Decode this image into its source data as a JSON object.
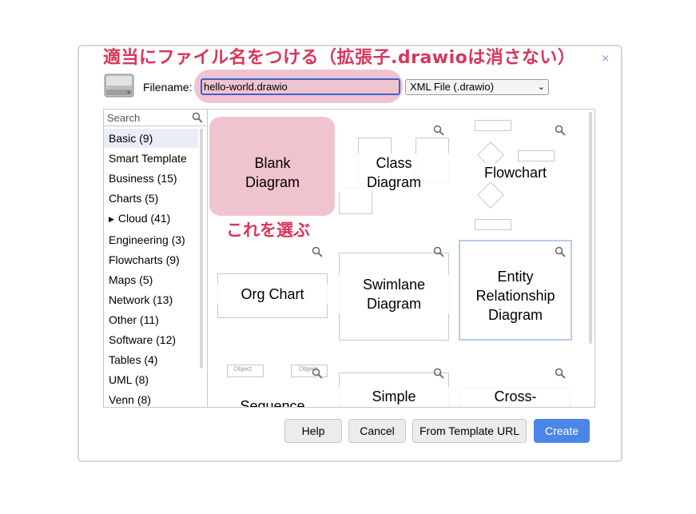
{
  "annotations": {
    "top": "適当にファイル名をつける（拡張子.drawioは消さない）",
    "blank_hint": "これを選ぶ"
  },
  "header": {
    "filename_label": "Filename:",
    "filename_value": "hello-world.drawio",
    "filetype_value": "XML File (.drawio)",
    "close": "×"
  },
  "sidebar": {
    "search_placeholder": "Search",
    "categories": [
      {
        "label": "Basic (9)"
      },
      {
        "label": "Smart Template"
      },
      {
        "label": "Business (15)"
      },
      {
        "label": "Charts (5)"
      },
      {
        "label": "Cloud (41)",
        "arrow": "▶"
      },
      {
        "label": "Engineering (3)"
      },
      {
        "label": "Flowcharts (9)"
      },
      {
        "label": "Maps (5)"
      },
      {
        "label": "Network (13)"
      },
      {
        "label": "Other (11)"
      },
      {
        "label": "Software (12)"
      },
      {
        "label": "Tables (4)"
      },
      {
        "label": "UML (8)"
      },
      {
        "label": "Venn (8)"
      }
    ]
  },
  "templates": {
    "blank_1": "Blank",
    "blank_2": "Diagram",
    "class_1": "Class",
    "class_2": "Diagram",
    "flowchart": "Flowchart",
    "org": "Org Chart",
    "swim_1": "Swimlane",
    "swim_2": "Diagram",
    "er_1": "Entity",
    "er_2": "Relationship",
    "er_3": "Diagram",
    "sequence": "Sequence",
    "simple": "Simple",
    "cross": "Cross-",
    "seq_object_1": "Object",
    "seq_object_2": "Object"
  },
  "buttons": {
    "help": "Help",
    "cancel": "Cancel",
    "from_url": "From Template URL",
    "create": "Create"
  },
  "colors": {
    "annotation": "#d9365a",
    "highlight": "#f0c4cf",
    "primary": "#4a86e8"
  }
}
